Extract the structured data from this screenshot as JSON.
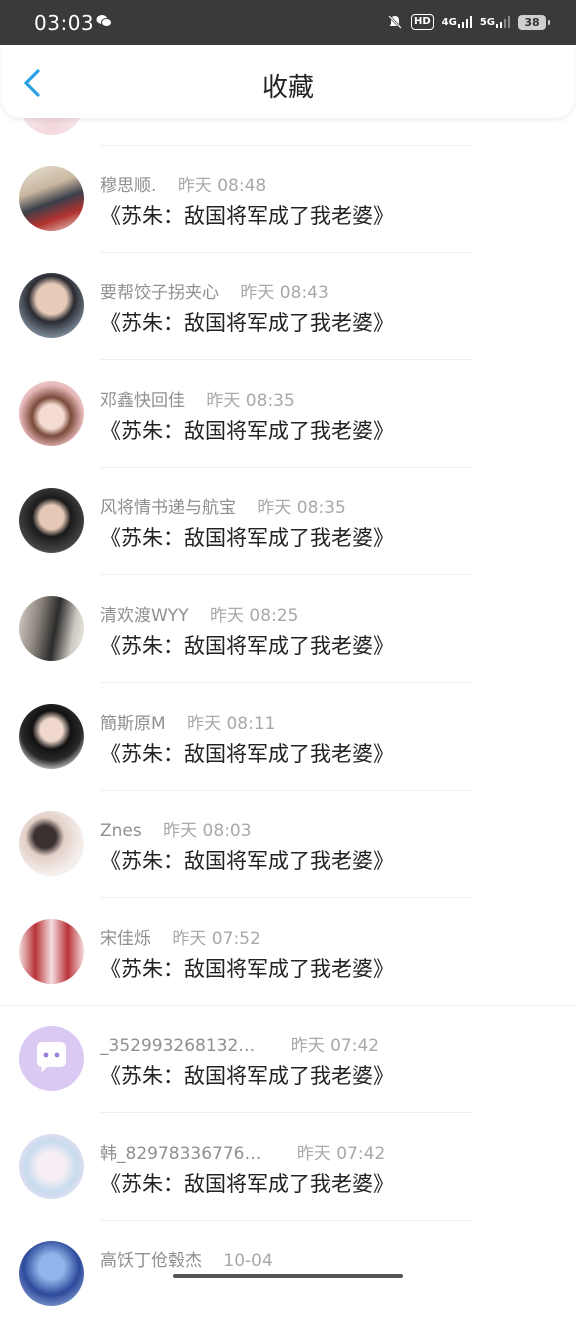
{
  "status_bar": {
    "time": "03:03",
    "network_4g": "4G",
    "network_5g": "5G",
    "hd": "HD",
    "battery": "38"
  },
  "header": {
    "title": "收藏"
  },
  "colors": {
    "accent": "#2aa0e6",
    "status_bar_bg": "#3a3a3a"
  },
  "items": [
    {
      "name": "穆思顺.",
      "time": "昨天  08:48",
      "title": "《苏朱：敌国将军成了我老婆》"
    },
    {
      "name": "要帮饺子拐夹心",
      "time": "昨天  08:43",
      "title": "《苏朱：敌国将军成了我老婆》"
    },
    {
      "name": "邓鑫快回佳",
      "time": "昨天  08:35",
      "title": "《苏朱：敌国将军成了我老婆》"
    },
    {
      "name": "风将情书递与航宝",
      "time": "昨天  08:35",
      "title": "《苏朱：敌国将军成了我老婆》"
    },
    {
      "name": "清欢渡WYY",
      "time": "昨天  08:25",
      "title": "《苏朱：敌国将军成了我老婆》"
    },
    {
      "name": "簡斯原M",
      "time": "昨天  08:11",
      "title": "《苏朱：敌国将军成了我老婆》"
    },
    {
      "name": "Znes",
      "time": "昨天  08:03",
      "title": "《苏朱：敌国将军成了我老婆》"
    },
    {
      "name": "宋佳烁",
      "time": "昨天  07:52",
      "title": "《苏朱：敌国将军成了我老婆》"
    },
    {
      "name": "_352993268132…",
      "time": "昨天  07:42",
      "title": "《苏朱：敌国将军成了我老婆》"
    },
    {
      "name": "韩_82978336776…",
      "time": "昨天  07:42",
      "title": "《苏朱：敌国将军成了我老婆》"
    },
    {
      "name": "高饫丁伧毂杰",
      "time": "10-04",
      "title": ""
    }
  ]
}
